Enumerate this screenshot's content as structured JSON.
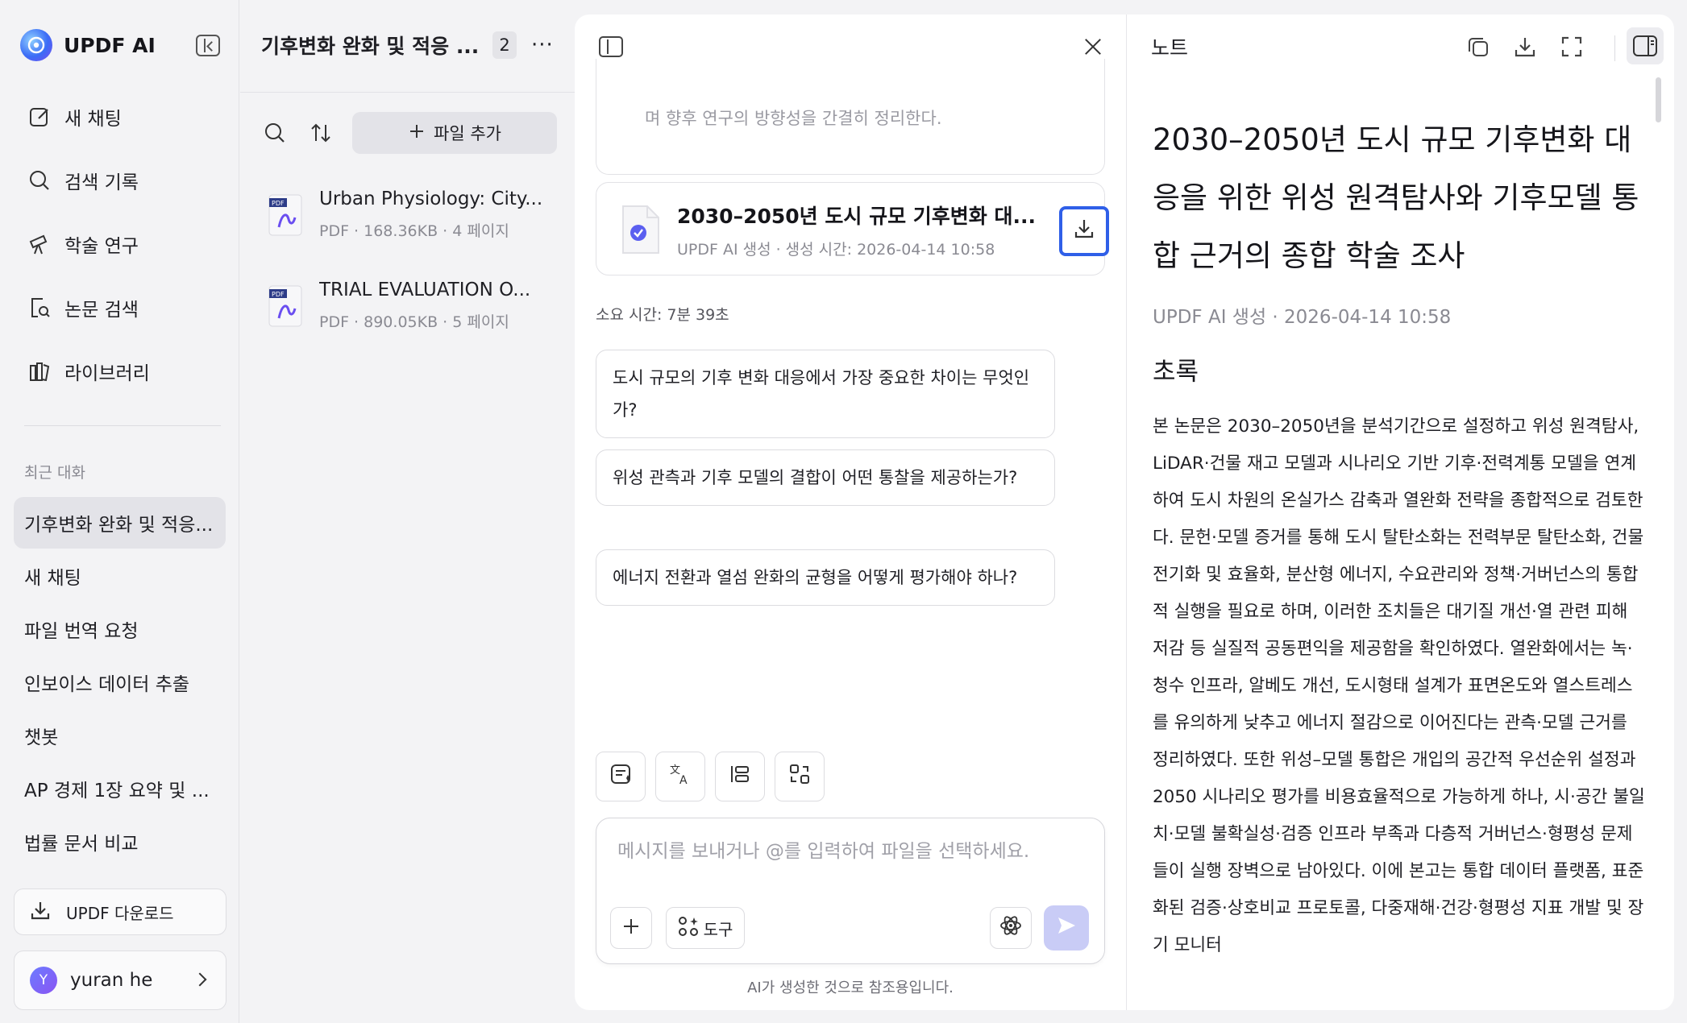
{
  "sidebar": {
    "brand": "UPDF AI",
    "nav": [
      "새 채팅",
      "검색 기록",
      "학술 연구",
      "논문 검색",
      "라이브러리"
    ],
    "recent_title": "최근 대화",
    "recent": [
      "기후변화 완화 및 적응...",
      "새 채팅",
      "파일 번역 요청",
      "인보이스 데이터 추출",
      "챗봇",
      "AP 경제 1장 요약 및 ...",
      "법률 문서 비교"
    ],
    "download_label": "UPDF 다운로드",
    "user_initial": "Y",
    "user_name": "yuran he"
  },
  "files": {
    "title": "기후변화 완화 및 적응 ...",
    "count": "2",
    "more": "···",
    "add_label": "파일 추가",
    "items": [
      {
        "name": "Urban Physiology: City...",
        "meta": "PDF · 168.36KB · 4 페이지"
      },
      {
        "name": "TRIAL EVALUATION O...",
        "meta": "PDF · 890.05KB · 5 페이지"
      }
    ]
  },
  "chat": {
    "prev_card_text": "며 향후 연구의 방향성을 간결히 정리한다.",
    "doc": {
      "title": "2030–2050년 도시 규모 기후변화 대...",
      "meta": "UPDF AI 생성 · 생성 시간: 2026-04-14 10:58"
    },
    "elapsed": "소요 시간: 7분 39초",
    "suggestions": [
      "도시 규모의 기후 변화 대응에서 가장 중요한 차이는 무엇인가?",
      "위성 관측과 기후 모델의 결합이 어떤 통찰을 제공하는가?",
      "에너지 전환과 열섬 완화의 균형을 어떻게 평가해야 하나?"
    ],
    "input_placeholder": "메시지를 보내거나 @를 입력하여 파일을 선택하세요.",
    "tools_label": "도구",
    "disclaimer": "AI가 생성한 것으로 참조용입니다."
  },
  "note": {
    "title": "노트",
    "heading": "2030–2050년 도시 규모 기후변화 대응을 위한 위성 원격탐사와 기후모델 통합 근거의 종합 학술 조사",
    "meta": "UPDF AI 생성 · 2026-04-14 10:58",
    "section": "초록",
    "abstract": "본 논문은 2030–2050년을 분석기간으로 설정하고 위성 원격탐사, LiDAR·건물 재고 모델과 시나리오 기반 기후·전력계통 모델을 연계하여 도시 차원의 온실가스 감축과 열완화 전략을 종합적으로 검토한다. 문헌·모델 증거를 통해 도시 탈탄소화는 전력부문 탈탄소화, 건물 전기화 및 효율화, 분산형 에너지, 수요관리와 정책·거버넌스의 통합적 실행을 필요로 하며, 이러한 조치들은 대기질 개선·열 관련 피해 저감 등 실질적 공동편익을 제공함을 확인하였다. 열완화에서는 녹·청수 인프라, 알베도 개선, 도시형태 설계가 표면온도와 열스트레스를 유의하게 낮추고 에너지 절감으로 이어진다는 관측·모델 근거를 정리하였다. 또한 위성–모델 통합은 개입의 공간적 우선순위 설정과 2050 시나리오 평가를 비용효율적으로 가능하게 하나, 시·공간 불일치·모델 불확실성·검증 인프라 부족과 다층적 거버넌스·형평성 문제들이 실행 장벽으로 남아있다. 이에 본고는 통합 데이터 플랫폼, 표준화된 검증·상호비교 프로토콜, 다중재해·건강·형평성 지표 개발 및 장기 모니터"
  }
}
